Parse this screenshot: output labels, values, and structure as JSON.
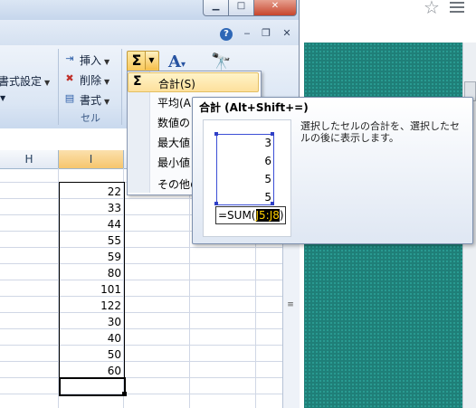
{
  "window": {
    "minimize": "▁",
    "maximize": "□",
    "close": "✕",
    "help": "?",
    "ribbon_min": "‒",
    "ribbon_restore": "❐",
    "ribbon_close": "✕"
  },
  "ribbon": {
    "format_settings": "書式設定",
    "insert": "挿入",
    "delete": "削除",
    "format": "書式",
    "cells_group": "セル",
    "sigma_icon": "Σ"
  },
  "sheet": {
    "col_h": "H",
    "col_i": "I",
    "values": [
      "22",
      "33",
      "44",
      "55",
      "59",
      "80",
      "101",
      "122",
      "30",
      "40",
      "50",
      "60"
    ]
  },
  "menu": {
    "sum": "合計(S)",
    "average": "平均(A",
    "count": "数値の",
    "max": "最大値",
    "min": "最小値",
    "other": "その他の"
  },
  "tooltip": {
    "title": "合計 (Alt+Shift+=)",
    "example_values": [
      "3",
      "6",
      "5",
      "5"
    ],
    "formula_prefix": "=SUM(",
    "formula_ref": "J5:J8",
    "formula_suffix": ")",
    "description": "選択したセルの合計を、選択したセルの後に表示します。"
  },
  "icons": {
    "star": "star-icon",
    "menu": "hamburger-icon"
  }
}
